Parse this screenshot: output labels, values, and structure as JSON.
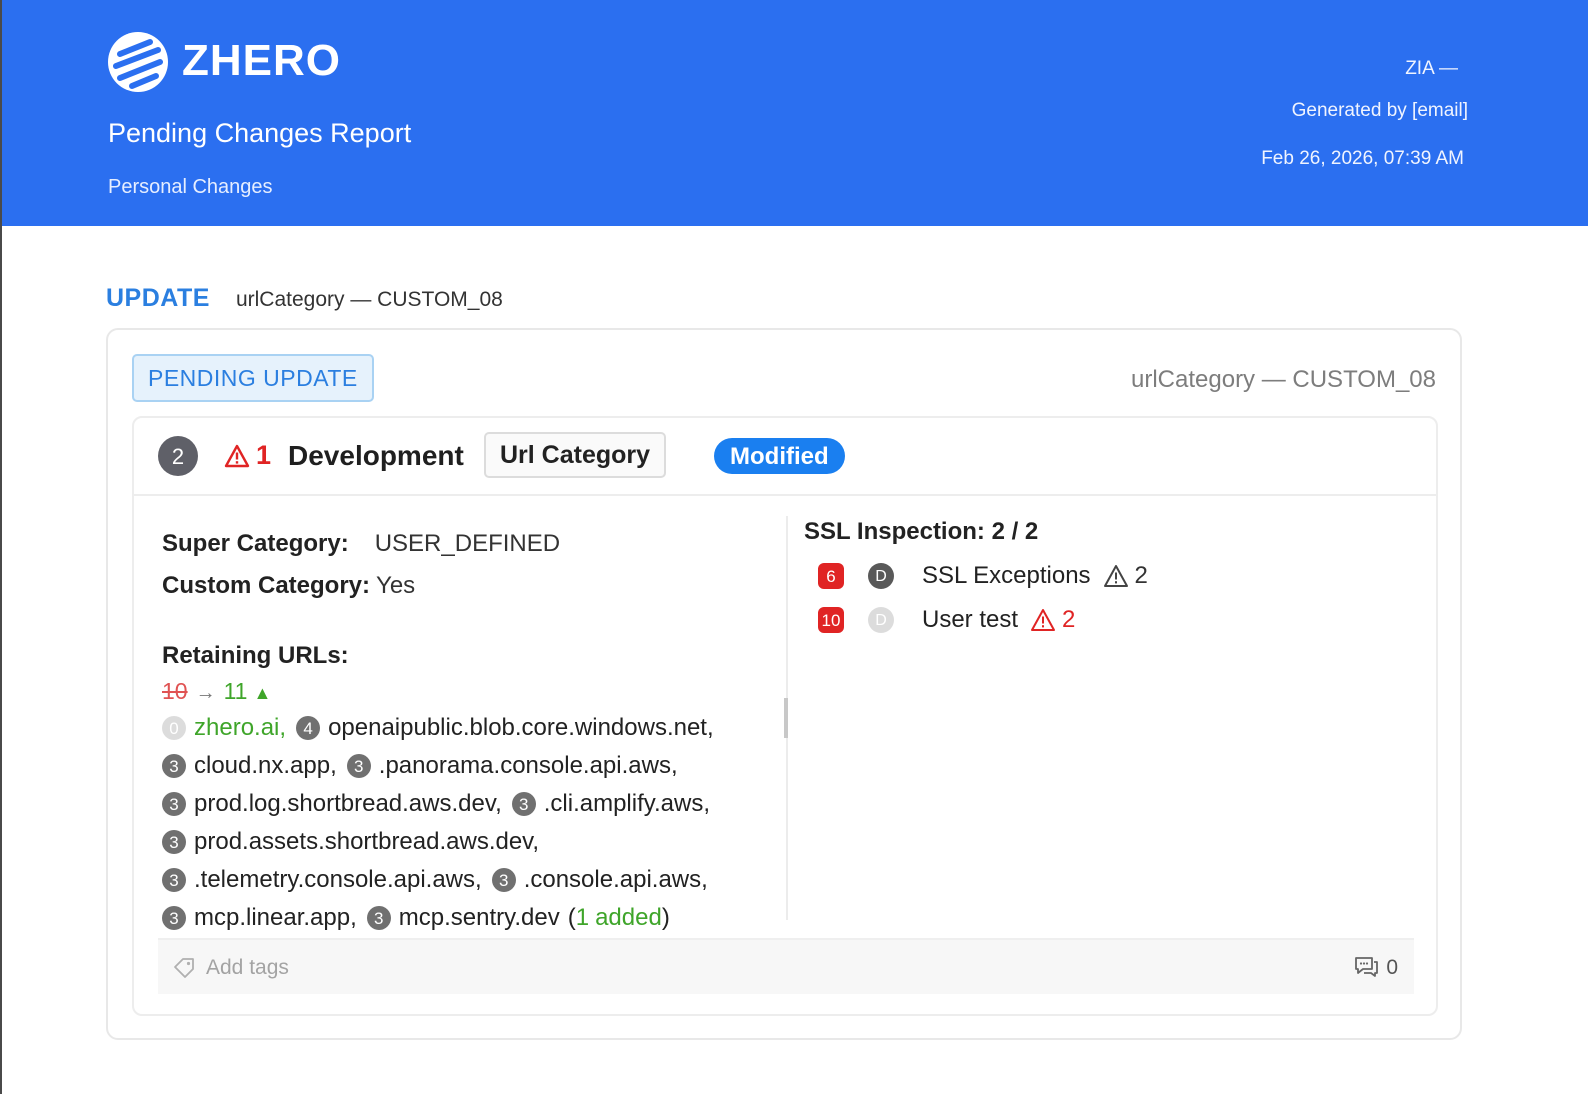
{
  "header": {
    "brand": "ZHERO",
    "title": "Pending Changes Report",
    "subtitle": "Personal Changes",
    "meta_line1": "ZIA —",
    "meta_line2": "Generated by [email]",
    "meta_line3": "Feb 26, 2026, 07:39 AM"
  },
  "section": {
    "action": "UPDATE",
    "name": "urlCategory — CUSTOM_08"
  },
  "card": {
    "badge": "PENDING UPDATE",
    "id_label": "urlCategory — CUSTOM_08",
    "item": {
      "count": "2",
      "warn_count": "1",
      "env": "Development",
      "type": "Url Category",
      "status": "Modified"
    },
    "details": {
      "super_category_label": "Super Category:",
      "super_category_value": "USER_DEFINED",
      "custom_category_label": "Custom Category:",
      "custom_category_value": "Yes",
      "retaining_label": "Retaining URLs:",
      "old_count": "10",
      "arrow": "→",
      "new_count": "11",
      "url_rows": [
        [
          {
            "badge": "0",
            "text": "zhero.ai,",
            "added": true
          },
          {
            "badge": "4",
            "text": "openaipublic.blob.core.windows.net,"
          }
        ],
        [
          {
            "badge": "3",
            "text": "cloud.nx.app,"
          },
          {
            "badge": "3",
            "text": ".panorama.console.api.aws,"
          }
        ],
        [
          {
            "badge": "3",
            "text": "prod.log.shortbread.aws.dev,"
          },
          {
            "badge": "3",
            "text": ".cli.amplify.aws,"
          }
        ],
        [
          {
            "badge": "3",
            "text": "prod.assets.shortbread.aws.dev,"
          }
        ],
        [
          {
            "badge": "3",
            "text": ".telemetry.console.api.aws,"
          },
          {
            "badge": "3",
            "text": ".console.api.aws,"
          }
        ],
        [
          {
            "badge": "3",
            "text": "mcp.linear.app,"
          },
          {
            "badge": "3",
            "text": "mcp.sentry.dev"
          }
        ]
      ],
      "added_open": "(",
      "added_count": "1",
      "added_word": "added",
      "added_close": ")"
    },
    "ssl": {
      "title": "SSL Inspection: 2 / 2",
      "rows": [
        {
          "count": "6",
          "d": "D",
          "name": "SSL Exceptions",
          "warn": "2",
          "tone": "dark"
        },
        {
          "count": "10",
          "d": "D",
          "name": "User test",
          "warn": "2",
          "tone": "red"
        }
      ]
    },
    "footer": {
      "add_tags": "Add tags",
      "comments": "0"
    }
  },
  "colors": {
    "header_blue": "#2b6ff0",
    "accent_blue": "#2b7fe0",
    "modified_blue": "#1a7ff0",
    "warn_red": "#e02424",
    "added_green": "#3fa52a"
  }
}
